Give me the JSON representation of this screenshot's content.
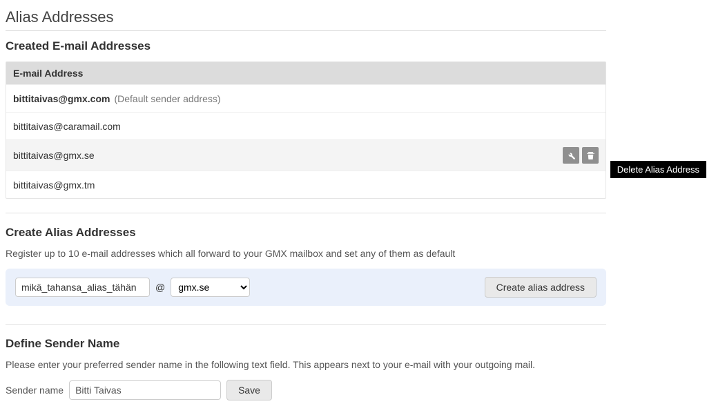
{
  "page_title": "Alias Addresses",
  "created_section": {
    "title": "Created E-mail Addresses",
    "header": "E-mail Address",
    "rows": [
      {
        "email": "bittitaivas@gmx.com",
        "suffix": "(Default sender address)",
        "bold": true,
        "hovered": false
      },
      {
        "email": "bittitaivas@caramail.com",
        "suffix": "",
        "bold": false,
        "hovered": false
      },
      {
        "email": "bittitaivas@gmx.se",
        "suffix": "",
        "bold": false,
        "hovered": true
      },
      {
        "email": "bittitaivas@gmx.tm",
        "suffix": "",
        "bold": false,
        "hovered": false
      }
    ],
    "tooltip": "Delete Alias Address"
  },
  "create_section": {
    "title": "Create Alias Addresses",
    "desc": "Register up to 10 e-mail addresses which all forward to your GMX mailbox and set any of them as default",
    "alias_value": "mikä_tahansa_alias_tähän",
    "at": "@",
    "domain_value": "gmx.se",
    "button": "Create alias address"
  },
  "sender_section": {
    "title": "Define Sender Name",
    "desc": "Please enter your preferred sender name in the following text field. This appears next to your e-mail with your outgoing mail.",
    "label": "Sender name",
    "value": "Bitti Taivas",
    "button": "Save"
  }
}
